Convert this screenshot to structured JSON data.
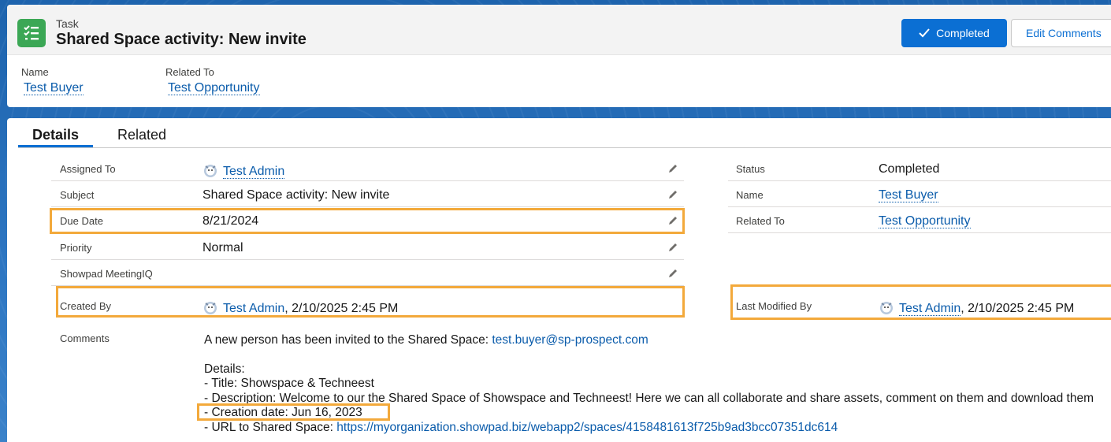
{
  "header": {
    "entity_label": "Task",
    "title": "Shared Space activity: New invite",
    "completed_label": "Completed",
    "edit_comments_label": "Edit Comments",
    "fields": [
      {
        "label": "Name",
        "value": "Test Buyer"
      },
      {
        "label": "Related To",
        "value": "Test Opportunity"
      }
    ]
  },
  "tabs": [
    {
      "label": "Details",
      "active": true
    },
    {
      "label": "Related",
      "active": false
    }
  ],
  "left_fields": [
    {
      "label": "Assigned To",
      "value": "Test Admin"
    },
    {
      "label": "Subject",
      "value": "Shared Space activity: New invite"
    },
    {
      "label": "Due Date",
      "value": "8/21/2024"
    },
    {
      "label": "Priority",
      "value": "Normal"
    },
    {
      "label": "Showpad MeetingIQ",
      "value": ""
    },
    {
      "label": "Created By",
      "value": "Test Admin",
      "suffix": ", 2/10/2025 2:45 PM"
    }
  ],
  "right_fields": [
    {
      "label": "Status",
      "value": "Completed"
    },
    {
      "label": "Name",
      "value": "Test Buyer"
    },
    {
      "label": "Related To",
      "value": "Test Opportunity"
    },
    {
      "label": "Last Modified By",
      "value": "Test Admin",
      "suffix": ", 2/10/2025 2:45 PM"
    }
  ],
  "comments": {
    "label": "Comments",
    "line1_text": "A new person has been invited to the Shared Space: ",
    "line1_email": "test.buyer@sp-prospect.com",
    "details_heading": "Details:",
    "title_line": "- Title: Showspace & Techneest",
    "description_line": "- Description: Welcome to our the Shared Space of Showspace and Techneest! Here we can all collaborate and share assets, comment on them and download them",
    "creation_line": "- Creation date: Jun 16, 2023",
    "url_prefix": "- URL to Shared Space: ",
    "url": "https://myorganization.showpad.biz/webapp2/spaces/4158481613f725b9ad3bcc07351dc614"
  },
  "colors": {
    "brand_blue": "#0b6fd3",
    "link_blue": "#0b5cab",
    "task_green": "#3ba755",
    "highlight_orange": "#f3a93b"
  },
  "icons": {
    "task": "task-list-icon",
    "check": "check-icon",
    "edit": "pencil-icon",
    "avatar": "user-avatar-icon"
  }
}
